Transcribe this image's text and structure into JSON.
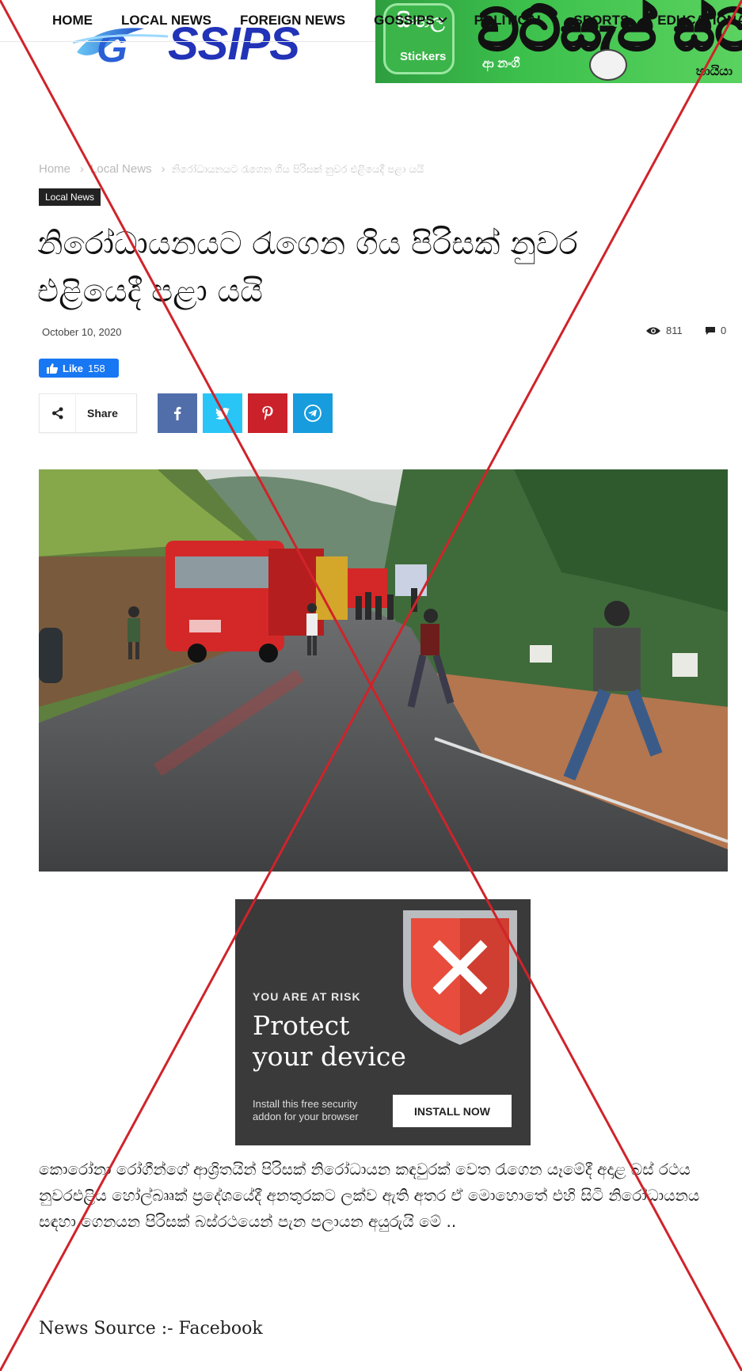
{
  "header": {
    "logo_text": "SSIPS",
    "nav": [
      "HOME",
      "LOCAL NEWS",
      "FOREIGN NEWS",
      "GOSSIPS",
      "POLITICAL",
      "SPORTS",
      "EDUCATIONAL"
    ],
    "banner_ad": {
      "app_title": "සිංහල",
      "app_label": "Stickers",
      "headline": "වට්සැප් ස්ට",
      "sub_left": "ආ නංගී",
      "sub_right": "හායියා"
    }
  },
  "breadcrumb": {
    "home": "Home",
    "section": "Local News",
    "current": "නිරෝධායනයට රැගෙන ගිය පිරිසක් නුවර එළියෙදී පළා යයි"
  },
  "category_badge": "Local News",
  "article": {
    "title": "නිරෝධායනයට රැගෙන ගිය පිරිසක් නුවර එළියෙදී පළා යයි",
    "date": "October 10, 2020",
    "views": "811",
    "comments": "0",
    "like_label": "Like",
    "like_count": "158",
    "share_label": "Share",
    "body": "කොරෝනා රෝගීන්ගේ ආශ්‍රිතයින් පිරිසක් නිරෝධායන කඳවුරක් වෙත රැගෙන යෑමේදී අදාළ බස් රථය නුවරඑළිය හෝල්බෲක් ප්‍රදේශයේදී අනතුරකට ලක්ව ඇති අතර ඒ මොහොතේ එහි සිටි නිරෝධායනය සඳහා ගෙනයන පිරිසක් බස්රථයෙන් පැන පලායන අයුරුයි මේ ..",
    "source": "News Source :- Facebook"
  },
  "ad": {
    "risk": "YOU ARE AT RISK",
    "headline_1": "Protect",
    "headline_2": "your device",
    "small_text": "Install this free security addon for your browser",
    "button": "INSTALL NOW"
  },
  "colors": {
    "facebook": "#3b5998",
    "twitter": "#1da1f2",
    "pinterest": "#ca212a",
    "telegram": "#179cde",
    "fb_like": "#1877f2",
    "cross": "#d0232a"
  }
}
